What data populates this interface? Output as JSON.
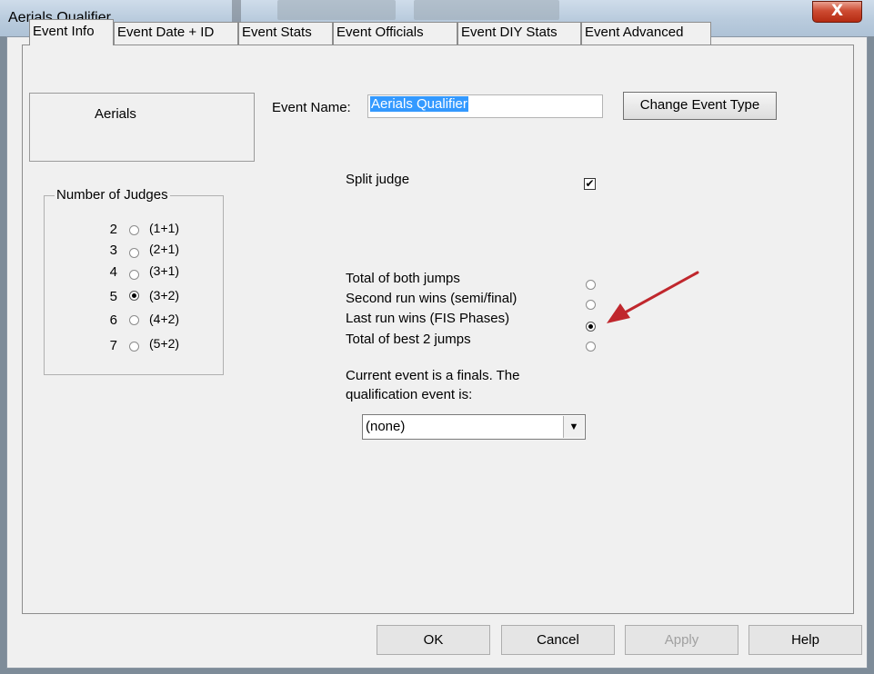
{
  "window": {
    "title": "Aerials Qualifier",
    "close_label": "X"
  },
  "tabs": [
    {
      "label": "Event Info"
    },
    {
      "label": "Event  Date + ID"
    },
    {
      "label": "Event  Stats"
    },
    {
      "label": "Event  Officials"
    },
    {
      "label": "Event  DIY Stats"
    },
    {
      "label": "Event  Advanced"
    }
  ],
  "event_type": {
    "label": "Aerials"
  },
  "event_name": {
    "label": "Event Name:",
    "value": "Aerials Qualifier"
  },
  "change_event_type_button": "Change Event Type",
  "judges": {
    "legend": "Number of Judges",
    "options": [
      {
        "num": "2",
        "ratio": "(1+1)",
        "selected": false
      },
      {
        "num": "3",
        "ratio": "(2+1)",
        "selected": false
      },
      {
        "num": "4",
        "ratio": "(3+1)",
        "selected": false
      },
      {
        "num": "5",
        "ratio": "(3+2)",
        "selected": true
      },
      {
        "num": "6",
        "ratio": "(4+2)",
        "selected": false
      },
      {
        "num": "7",
        "ratio": "(5+2)",
        "selected": false
      }
    ]
  },
  "split_judge": {
    "label": "Split judge",
    "checked": true,
    "check_glyph": "✔"
  },
  "scoring": {
    "options": [
      {
        "label": "Total of both jumps",
        "selected": false
      },
      {
        "label": "Second run wins (semi/final)",
        "selected": false
      },
      {
        "label": "Last run wins (FIS Phases)",
        "selected": true
      },
      {
        "label": "Total of best 2 jumps",
        "selected": false
      }
    ]
  },
  "qualification": {
    "line1": "Current event is a finals. The",
    "line2": "qualification event is:",
    "selected": "(none)",
    "arrow_glyph": "▼"
  },
  "annotation_color": "#c0272d",
  "buttons": {
    "ok": "OK",
    "cancel": "Cancel",
    "apply": "Apply",
    "help": "Help"
  }
}
